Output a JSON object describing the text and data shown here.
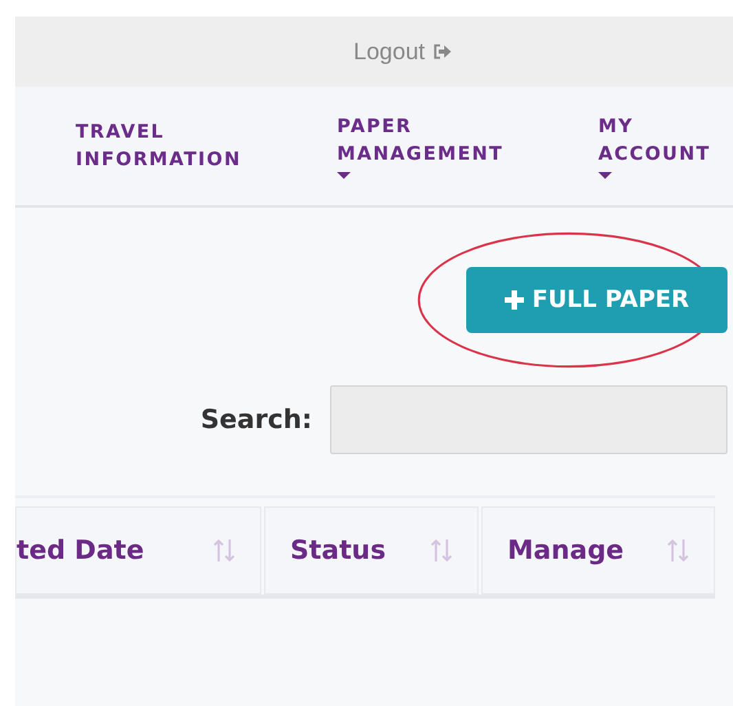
{
  "top_bar": {
    "logout": "Logout"
  },
  "nav": [
    {
      "label": "TRAVEL INFORMATION",
      "dropdown": false
    },
    {
      "label": "PAPER MANAGEMENT",
      "dropdown": true
    },
    {
      "label": "MY ACCOUNT",
      "dropdown": true
    }
  ],
  "add_button": {
    "label": "FULL PAPER",
    "highlighted": true
  },
  "search": {
    "label": "Search:"
  },
  "table": {
    "columns": [
      "ted Date",
      "Status",
      "Manage"
    ]
  }
}
